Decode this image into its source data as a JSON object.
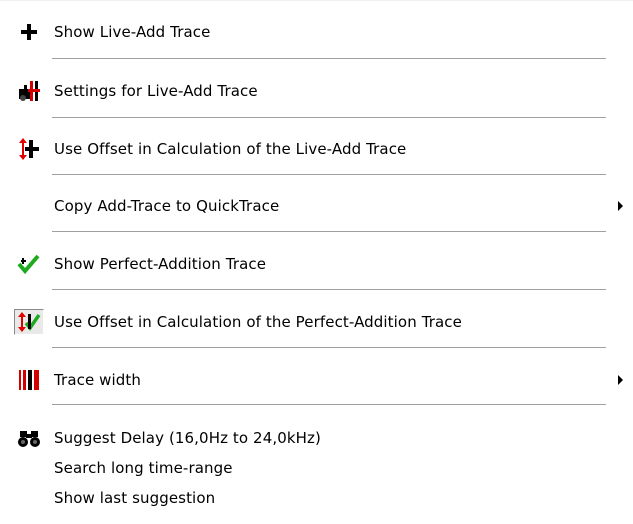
{
  "menu": {
    "items": [
      {
        "label": "Show Live-Add Trace",
        "icon": "plus-icon"
      },
      {
        "label": "Settings for Live-Add Trace",
        "icon": "settings-trace-icon"
      },
      {
        "label": "Use Offset in Calculation of the Live-Add Trace",
        "icon": "offset-plus-icon"
      },
      {
        "label": "Copy Add-Trace to QuickTrace",
        "icon": "",
        "submenu": true
      },
      {
        "label": "Show Perfect-Addition Trace",
        "icon": "green-check-icon"
      },
      {
        "label": "Use Offset in Calculation of the Perfect-Addition Trace",
        "icon": "offset-check-icon",
        "checked": true
      },
      {
        "label": "Trace width",
        "icon": "trace-width-icon",
        "submenu": true
      },
      {
        "label": "Suggest Delay (16,0Hz to 24,0kHz)",
        "icon": "binoculars-icon"
      },
      {
        "label": "Search long time-range",
        "icon": ""
      },
      {
        "label": "Show last suggestion",
        "icon": ""
      }
    ]
  },
  "colors": {
    "separator": "#a0a0a0",
    "offset_arrow": "#e00000",
    "check": "#1faa1f",
    "checked_bg": "#e9e9e9"
  }
}
